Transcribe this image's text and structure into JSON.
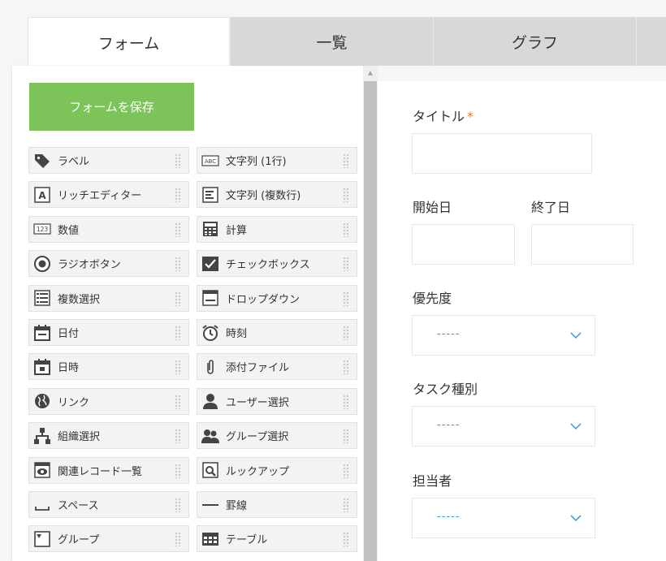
{
  "tabs": [
    {
      "label": "フォーム",
      "active": true
    },
    {
      "label": "一覧",
      "active": false
    },
    {
      "label": "グラフ",
      "active": false
    },
    {
      "label": "",
      "active": false
    }
  ],
  "palette": {
    "save_label": "フォームを保存",
    "items": [
      {
        "label": "ラベル",
        "icon": "tag-icon"
      },
      {
        "label": "文字列 (1行)",
        "icon": "abc-icon"
      },
      {
        "label": "リッチエディター",
        "icon": "rich-text-icon"
      },
      {
        "label": "文字列 (複数行)",
        "icon": "multiline-text-icon"
      },
      {
        "label": "数値",
        "icon": "number-icon"
      },
      {
        "label": "計算",
        "icon": "calculator-icon"
      },
      {
        "label": "ラジオボタン",
        "icon": "radio-icon"
      },
      {
        "label": "チェックボックス",
        "icon": "checkbox-icon"
      },
      {
        "label": "複数選択",
        "icon": "multi-select-icon"
      },
      {
        "label": "ドロップダウン",
        "icon": "dropdown-icon"
      },
      {
        "label": "日付",
        "icon": "calendar-icon"
      },
      {
        "label": "時刻",
        "icon": "clock-icon"
      },
      {
        "label": "日時",
        "icon": "datetime-icon"
      },
      {
        "label": "添付ファイル",
        "icon": "paperclip-icon"
      },
      {
        "label": "リンク",
        "icon": "globe-icon"
      },
      {
        "label": "ユーザー選択",
        "icon": "user-icon"
      },
      {
        "label": "組織選択",
        "icon": "org-icon"
      },
      {
        "label": "グループ選択",
        "icon": "group-icon"
      },
      {
        "label": "関連レコード一覧",
        "icon": "related-records-icon"
      },
      {
        "label": "ルックアップ",
        "icon": "lookup-icon"
      },
      {
        "label": "スペース",
        "icon": "space-icon"
      },
      {
        "label": "罫線",
        "icon": "line-icon"
      },
      {
        "label": "グループ",
        "icon": "group-field-icon"
      },
      {
        "label": "テーブル",
        "icon": "table-icon"
      }
    ]
  },
  "form": {
    "title_label": "タイトル",
    "required_mark": "*",
    "start_label": "開始日",
    "end_label": "終了日",
    "priority_label": "優先度",
    "priority_value": "-----",
    "task_type_label": "タスク種別",
    "task_type_value": "-----",
    "assignee_label": "担当者",
    "assignee_value": "-----"
  },
  "colors": {
    "save_button": "#7cc35a",
    "required": "#e07b2a",
    "select_accent": "#3498db"
  }
}
